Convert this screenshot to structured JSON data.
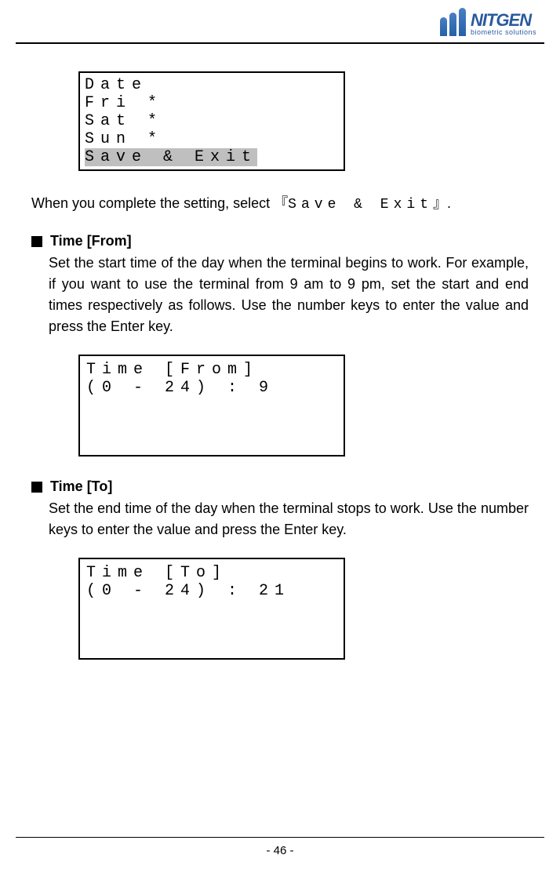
{
  "logo": {
    "name": "NITGEN",
    "tagline": "biometric solutions"
  },
  "lcd1": {
    "line1": "Date",
    "line2": "Fri *",
    "line3": "Sat *",
    "line4": "Sun *",
    "line5": "Save & Exit"
  },
  "para1_prefix": "When you complete the setting, select  『",
  "para1_mono": "Save  &  Exit",
  "para1_suffix": "』.",
  "section1": {
    "title": "Time [From]",
    "body": "Set the start time of the day when the terminal begins to work. For example, if you want to use the terminal from 9 am to 9 pm, set the start and end times respectively as follows. Use the number keys to enter the value and press the Enter key."
  },
  "lcd2": {
    "line1": "Time [From]",
    "line2": "(0 - 24) : 9"
  },
  "section2": {
    "title": "Time [To]",
    "body": "Set the end time of the day when the terminal stops to work. Use the number keys to enter the value and press the Enter key."
  },
  "lcd3": {
    "line1": "Time [To]",
    "line2": "(0 - 24) : 21"
  },
  "pageNumber": "- 46 -"
}
